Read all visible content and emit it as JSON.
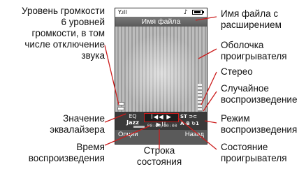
{
  "callouts": {
    "volume_level": [
      "Уровень громкости",
      "6 уровней",
      "громкости, в том",
      "числе отключение",
      "звука"
    ],
    "eq_value": [
      "Значение",
      "эквалайзера"
    ],
    "play_time": [
      "Время",
      "воспроизведения"
    ],
    "status_line": [
      "Строка",
      "состояния"
    ],
    "file_name": [
      "Имя файла с",
      "расширением"
    ],
    "player_skin": [
      "Оболочка",
      "проигрывателя"
    ],
    "stereo": "Стерео",
    "shuffle": [
      "Случайное",
      "воспроизведение"
    ],
    "play_mode": [
      "Режим",
      "воспроизведения"
    ],
    "player_state": [
      "Состояние",
      "проигрывателя"
    ]
  },
  "screen": {
    "signal": "Y.ıll",
    "music_note": "♪",
    "title": "Имя файла",
    "eq_label": "EQ",
    "eq_value": "Jazz",
    "controls": "I◀◀ ▶ ▶II",
    "time": "00:00/00:00",
    "stereo_badge": "ST",
    "shuffle_badge": "⊃⊂",
    "ab_badge": "A-B",
    "repeat_badge": "↻1",
    "softkey_left": "Опции",
    "softkey_right": "Назад",
    "volume_bars_total": 6,
    "volume_bars_on": 6
  }
}
